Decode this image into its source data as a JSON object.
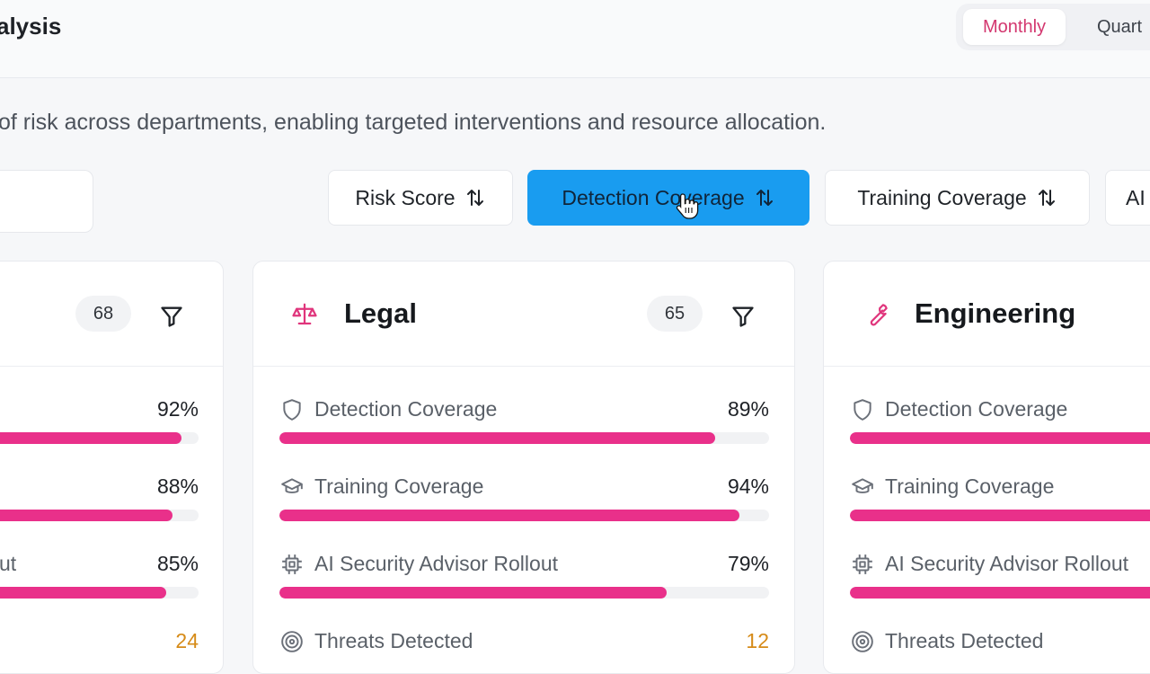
{
  "header": {
    "title": "alysis",
    "period_options": [
      {
        "label": "Monthly",
        "active": true
      },
      {
        "label": "Quart",
        "active": false
      }
    ]
  },
  "description": "of risk across departments, enabling targeted interventions and resource allocation.",
  "sort_buttons": [
    {
      "label": "Risk Score",
      "active": false
    },
    {
      "label": "Detection Coverage",
      "active": true
    },
    {
      "label": "Training Coverage",
      "active": false
    },
    {
      "label": "AI",
      "active": false
    }
  ],
  "cards": [
    {
      "name": "",
      "icon": "",
      "score": "68",
      "metrics": [
        {
          "icon": "",
          "label": "",
          "value": "92%",
          "progress": 0.92
        },
        {
          "icon": "",
          "label": "",
          "value": "88%",
          "progress": 0.88
        },
        {
          "icon": "",
          "label": "ut",
          "value": "85%",
          "progress": 0.85
        },
        {
          "icon": "",
          "label": "",
          "value": "24"
        }
      ]
    },
    {
      "name": "Legal",
      "icon": "scale-icon",
      "score": "65",
      "metrics": [
        {
          "icon": "shield-icon",
          "label": "Detection Coverage",
          "value": "89%",
          "progress": 0.89
        },
        {
          "icon": "graduation-cap-icon",
          "label": "Training Coverage",
          "value": "94%",
          "progress": 0.94
        },
        {
          "icon": "cpu-icon",
          "label": "AI Security Advisor Rollout",
          "value": "79%",
          "progress": 0.79
        },
        {
          "icon": "target-icon",
          "label": "Threats Detected",
          "value": "12"
        }
      ]
    },
    {
      "name": "Engineering",
      "icon": "wrench-icon",
      "score": "",
      "metrics": [
        {
          "icon": "shield-icon",
          "label": "Detection Coverage",
          "value": "",
          "progress": 1.0
        },
        {
          "icon": "graduation-cap-icon",
          "label": "Training Coverage",
          "value": "",
          "progress": 1.0
        },
        {
          "icon": "cpu-icon",
          "label": "AI Security Advisor Rollout",
          "value": "",
          "progress": 1.0
        },
        {
          "icon": "target-icon",
          "label": "Threats Detected",
          "value": ""
        }
      ]
    }
  ],
  "colors": {
    "accent_pink": "#e9308a",
    "active_blue": "#199cf0",
    "active_period_text": "#d3376f",
    "threat_orange": "#d68b18"
  }
}
